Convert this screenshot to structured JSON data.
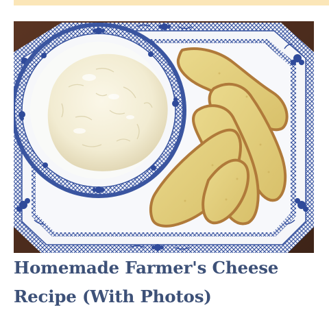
{
  "card": {
    "image_alt": "Homemade Farmer's Cheese with sliced bread on a blue and white plate",
    "title": "Homemade Farmer's Cheese Recipe (With Photos)"
  },
  "colors": {
    "top_bar": "#fbe6b8",
    "title": "#3d5178"
  }
}
